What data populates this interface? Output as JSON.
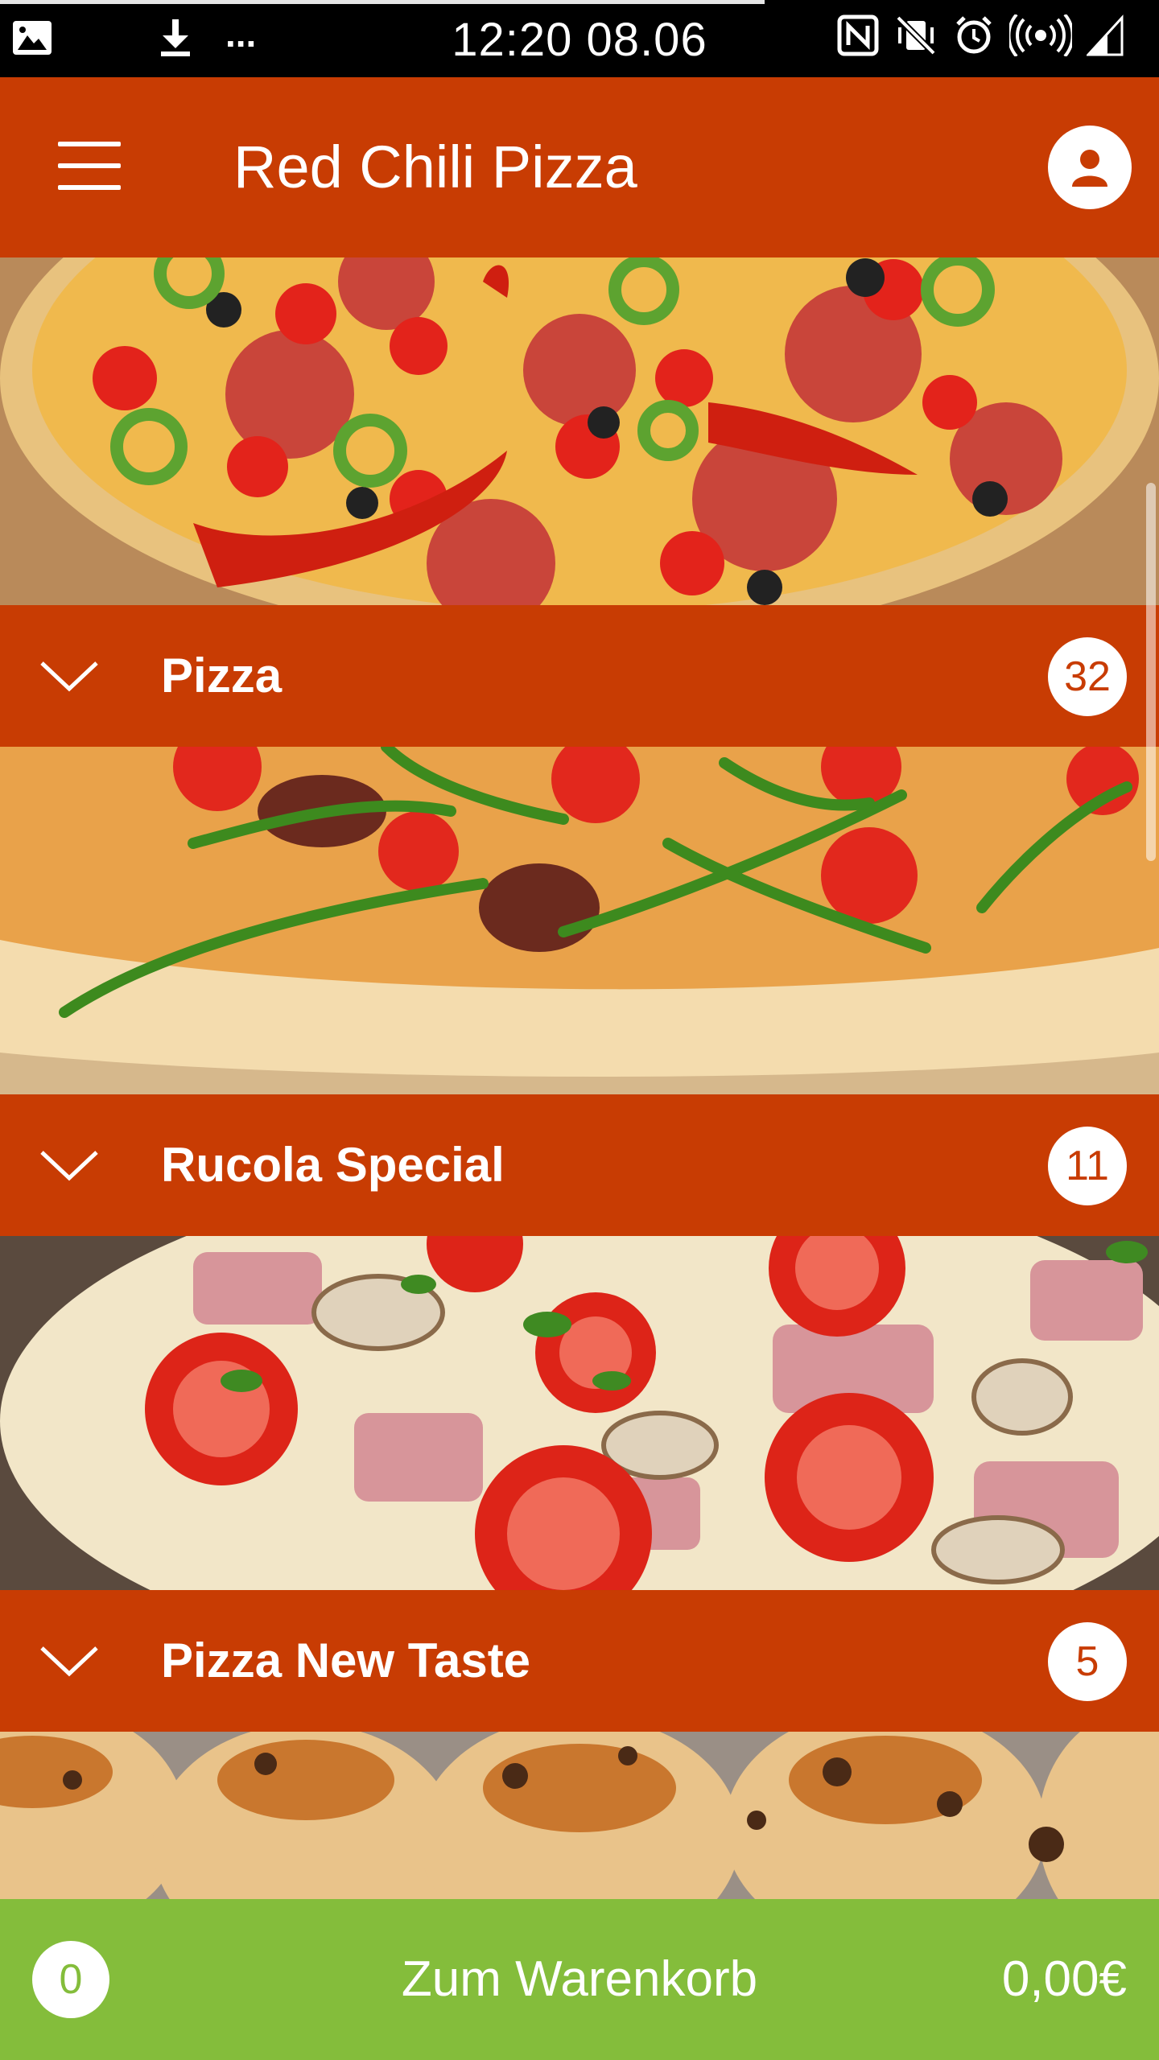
{
  "status_bar": {
    "time": "12:20 08.06",
    "left_icons": [
      "gallery-icon",
      "download-icon"
    ],
    "ellipsis": "...",
    "right_icons": [
      "nfc-icon",
      "mute-vibrate-icon",
      "alarm-icon",
      "hotspot-icon",
      "signal-icon"
    ]
  },
  "app_bar": {
    "title": "Red Chili Pizza",
    "menu_icon": "hamburger-menu-icon",
    "profile_icon": "user-profile-icon"
  },
  "categories": [
    {
      "title": "Pizza",
      "count": "32",
      "image": "pepperoni-pizza-photo"
    },
    {
      "title": "Rucola Special",
      "count": "11",
      "image": "rucola-pizza-photo"
    },
    {
      "title": "Pizza New Taste",
      "count": "5",
      "image": "ham-mushroom-pizza-photo"
    },
    {
      "image": "pizza-rolls-photo"
    }
  ],
  "cart": {
    "count": "0",
    "label": "Zum Warenkorb",
    "total": "0,00€"
  },
  "colors": {
    "primary": "#c83c03",
    "cart_green": "#84bd3b",
    "status_bar": "#000000"
  }
}
